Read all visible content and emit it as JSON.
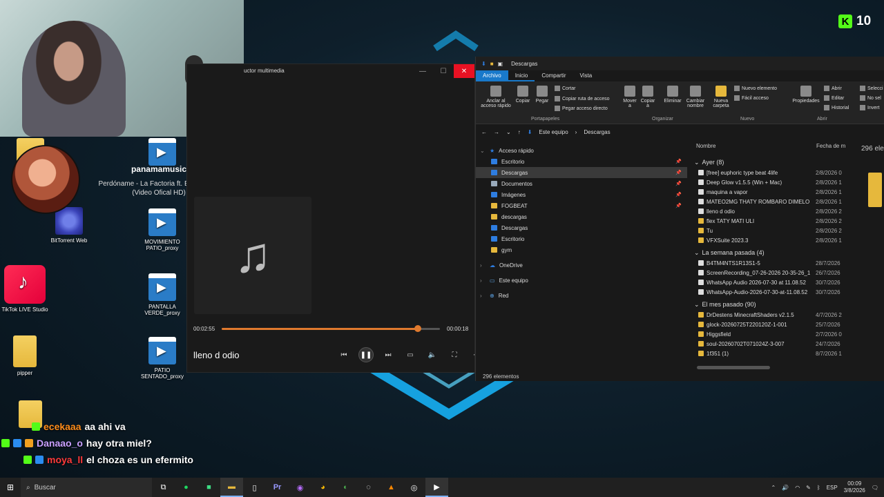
{
  "overlay": {
    "viewer_count": "10"
  },
  "notification": {
    "user": "panamamusic",
    "song": "Perdóname - La Factoria ft. Eddy Lover (Video Ofical HD)"
  },
  "desktop_icons": [
    {
      "label": "BitTorrent Web"
    },
    {
      "label": "MOVIMIENTO PATIO_proxy"
    },
    {
      "label": "TikTok LIVE Studio"
    },
    {
      "label": "PANTALLA VERDE_proxy"
    },
    {
      "label": "pipper"
    },
    {
      "label": "PATIO SENTADO_proxy"
    }
  ],
  "player": {
    "window_title": "uctor multimedia",
    "elapsed": "00:02:55",
    "remaining": "00:00:18",
    "progress": 0.9,
    "track_title": "lleno d odio"
  },
  "explorer": {
    "window_title": "Descargas",
    "tabs": [
      "Archivo",
      "Inicio",
      "Compartir",
      "Vista"
    ],
    "ribbon": {
      "pin": "Anclar al acceso rápido",
      "copy": "Copiar",
      "paste": "Pegar",
      "cut": "Cortar",
      "copy_path": "Copiar ruta de acceso",
      "paste_shortcut": "Pegar acceso directo",
      "group_clipboard": "Portapapeles",
      "move": "Mover a",
      "copy_to": "Copiar a",
      "delete": "Eliminar",
      "rename": "Cambiar nombre",
      "group_organize": "Organizar",
      "new_folder": "Nueva carpeta",
      "new_item": "Nuevo elemento",
      "easy_access": "Fácil acceso",
      "group_new": "Nuevo",
      "properties": "Propiedades",
      "open": "Abrir",
      "edit": "Editar",
      "history": "Historial",
      "group_open": "Abrir",
      "select_all": "Selecci",
      "select_none": "No sel",
      "invert": "Invert"
    },
    "breadcrumb": [
      "Este equipo",
      "Descargas"
    ],
    "nav": {
      "quick_access": "Acceso rápido",
      "items": [
        "Escritorio",
        "Descargas",
        "Documentos",
        "Imágenes",
        "FOGBEAT",
        "descargas",
        "Descargas",
        "Escritorio",
        "gym"
      ],
      "onedrive": "OneDrive",
      "this_pc": "Este equipo",
      "network": "Red"
    },
    "columns": {
      "name": "Nombre",
      "date": "Fecha de m"
    },
    "groups": [
      {
        "label": "Ayer (8)",
        "files": [
          {
            "name": "[free] euphoric type beat 4life",
            "date": "2/8/2026 0"
          },
          {
            "name": "Deep Glow v1.5.5 (Win + Mac)",
            "date": "2/8/2026 1"
          },
          {
            "name": "maquina a vapor",
            "date": "2/8/2026 1"
          },
          {
            "name": "MATEO2MG THATY ROMBARO DIMELO",
            "date": "2/8/2026 1"
          },
          {
            "name": "lleno d odio",
            "date": "2/8/2026 2"
          },
          {
            "name": "flex TATY MATI ULI",
            "date": "2/8/2026 2"
          },
          {
            "name": "Tu",
            "date": "2/8/2026 2"
          },
          {
            "name": "VFXSuite 2023.3",
            "date": "2/8/2026 1"
          }
        ]
      },
      {
        "label": "La semana pasada (4)",
        "files": [
          {
            "name": "B4TM4NTS1R13S1-5",
            "date": "28/7/2026"
          },
          {
            "name": "ScreenRecording_07-26-2026 20-35-26_1",
            "date": "26/7/2026"
          },
          {
            "name": "WhatsApp Audio 2026-07-30 at 11.08.52",
            "date": "30/7/2026"
          },
          {
            "name": "WhatsApp-Audio-2026-07-30-at-11.08.52",
            "date": "30/7/2026"
          }
        ]
      },
      {
        "label": "El mes pasado (90)",
        "files": [
          {
            "name": "DrDestens MinecraftShaders v2.1.5",
            "date": "4/7/2026 2"
          },
          {
            "name": "glock-20260725T220120Z-1-001",
            "date": "25/7/2026"
          },
          {
            "name": "Higgsfield",
            "date": "2/7/2026 0"
          },
          {
            "name": "soul-20260702T071024Z-3-007",
            "date": "24/7/2026"
          },
          {
            "name": "1f351 (1)",
            "date": "8/7/2026 1"
          }
        ]
      }
    ],
    "partial_count": "296 ele",
    "status": "296 elementos"
  },
  "chat": [
    {
      "user": "ecekaaa",
      "message": "aa ahi va",
      "color": "#ff8c1a"
    },
    {
      "user": "Danaao_o",
      "message": "hay otra miel?",
      "color": "#c9a0ff"
    },
    {
      "user": "moya_ll",
      "message": "el choza es un efermito",
      "color": "#ff3a3a"
    }
  ],
  "taskbar": {
    "search": "Buscar",
    "lang": "ESP",
    "time": "00:09",
    "date": "3/8/2026"
  }
}
